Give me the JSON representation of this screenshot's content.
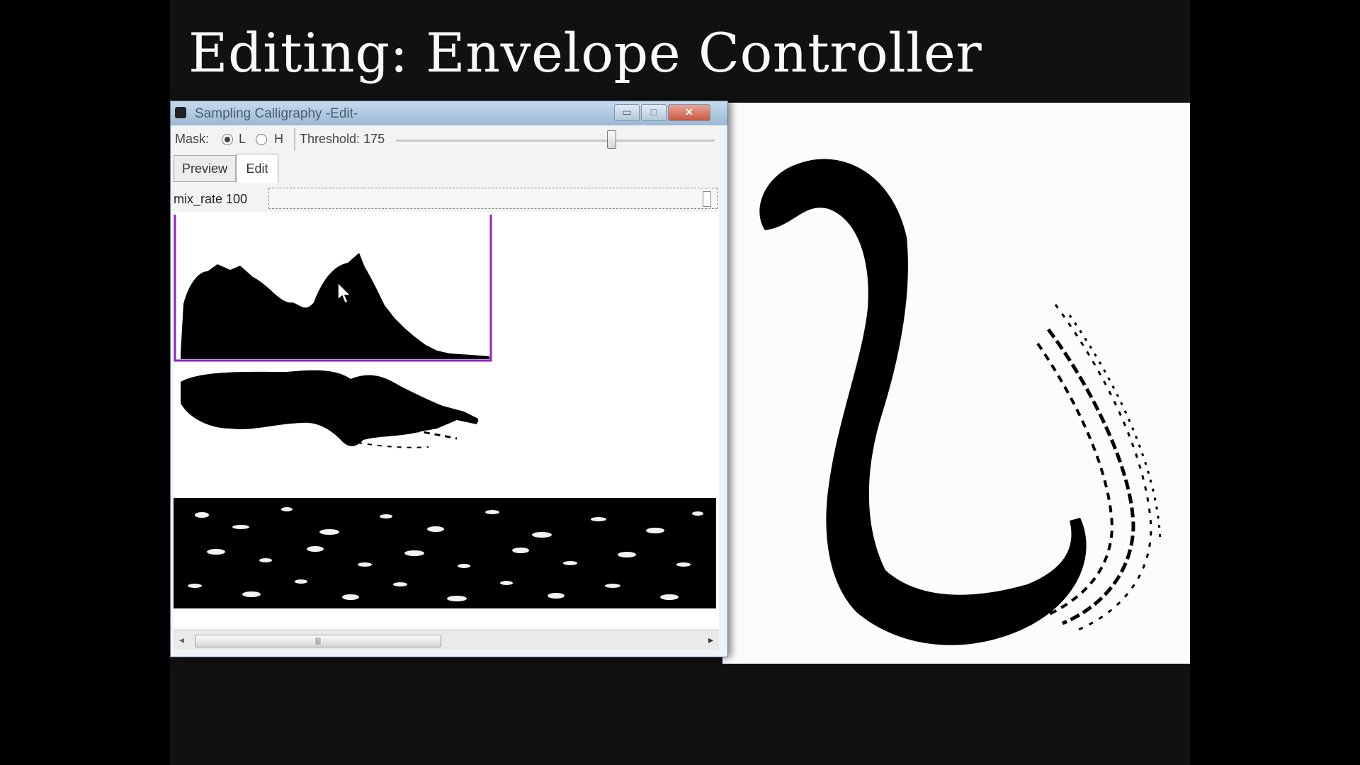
{
  "slide": {
    "title": "Editing: Envelope Controller"
  },
  "window": {
    "title": "Sampling Calligraphy -Edit-",
    "controls": {
      "minimize": "▭",
      "maximize": "□",
      "close": "✕"
    }
  },
  "toolbar": {
    "mask_label": "Mask:",
    "mask_options": [
      "L",
      "H"
    ],
    "mask_selected": "L",
    "threshold_label": "Threshold: 175",
    "threshold_value": 175
  },
  "tabs": [
    {
      "label": "Preview",
      "active": false
    },
    {
      "label": "Edit",
      "active": true
    }
  ],
  "mix_rate": {
    "label": "mix_rate  100",
    "value": 100
  },
  "scrollbar": {
    "left": "◂",
    "right": "▸",
    "grip": "|||"
  },
  "colors": {
    "envelope_frame": "#8f22c8",
    "ink": "#000000",
    "paper": "#fcfcfc",
    "background": "#111111"
  },
  "icons": [
    "app-icon",
    "mouse-cursor-icon",
    "scroll-left-arrow-icon",
    "scroll-right-arrow-icon"
  ]
}
